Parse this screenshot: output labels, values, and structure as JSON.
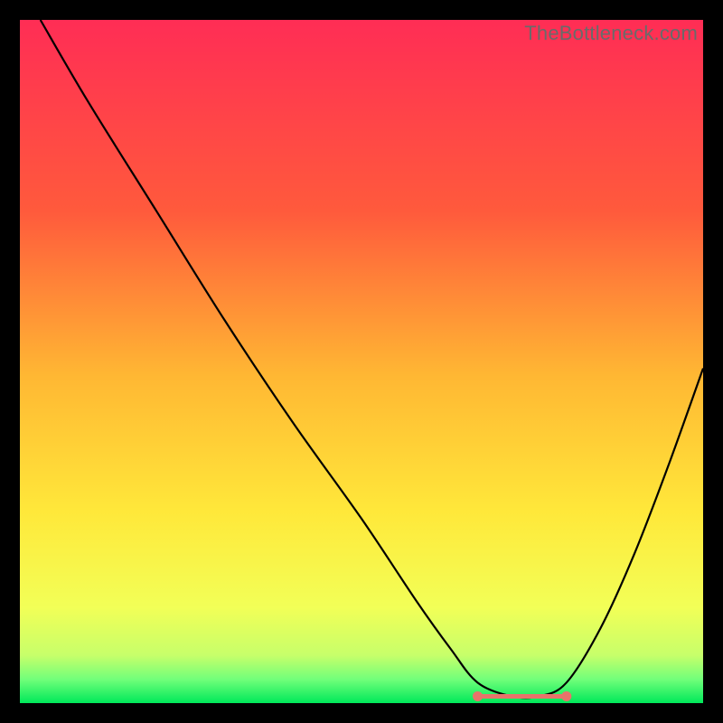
{
  "watermark": "TheBottleneck.com",
  "chart_data": {
    "type": "line",
    "title": "",
    "xlabel": "",
    "ylabel": "",
    "xlim": [
      0,
      100
    ],
    "ylim": [
      0,
      100
    ],
    "grid": false,
    "series": [
      {
        "name": "bottleneck-curve",
        "x": [
          3,
          10,
          20,
          30,
          40,
          50,
          58,
          63,
          67,
          72,
          76,
          80,
          85,
          90,
          95,
          100
        ],
        "y": [
          100,
          88,
          72,
          56,
          41,
          27,
          15,
          8,
          3,
          1,
          1,
          3,
          11,
          22,
          35,
          49
        ],
        "color": "#000000"
      }
    ],
    "flat_region": {
      "x_start": 67,
      "x_end": 80,
      "y": 1,
      "endpoint_dots": true,
      "dot_color": "#e8736a"
    },
    "background_gradient": {
      "stops": [
        {
          "offset": 0.0,
          "color": "#ff2d55"
        },
        {
          "offset": 0.28,
          "color": "#ff5a3c"
        },
        {
          "offset": 0.52,
          "color": "#ffb733"
        },
        {
          "offset": 0.72,
          "color": "#ffe83a"
        },
        {
          "offset": 0.86,
          "color": "#f2ff57"
        },
        {
          "offset": 0.93,
          "color": "#c7ff6a"
        },
        {
          "offset": 0.965,
          "color": "#72ff7a"
        },
        {
          "offset": 1.0,
          "color": "#00e85a"
        }
      ]
    }
  }
}
